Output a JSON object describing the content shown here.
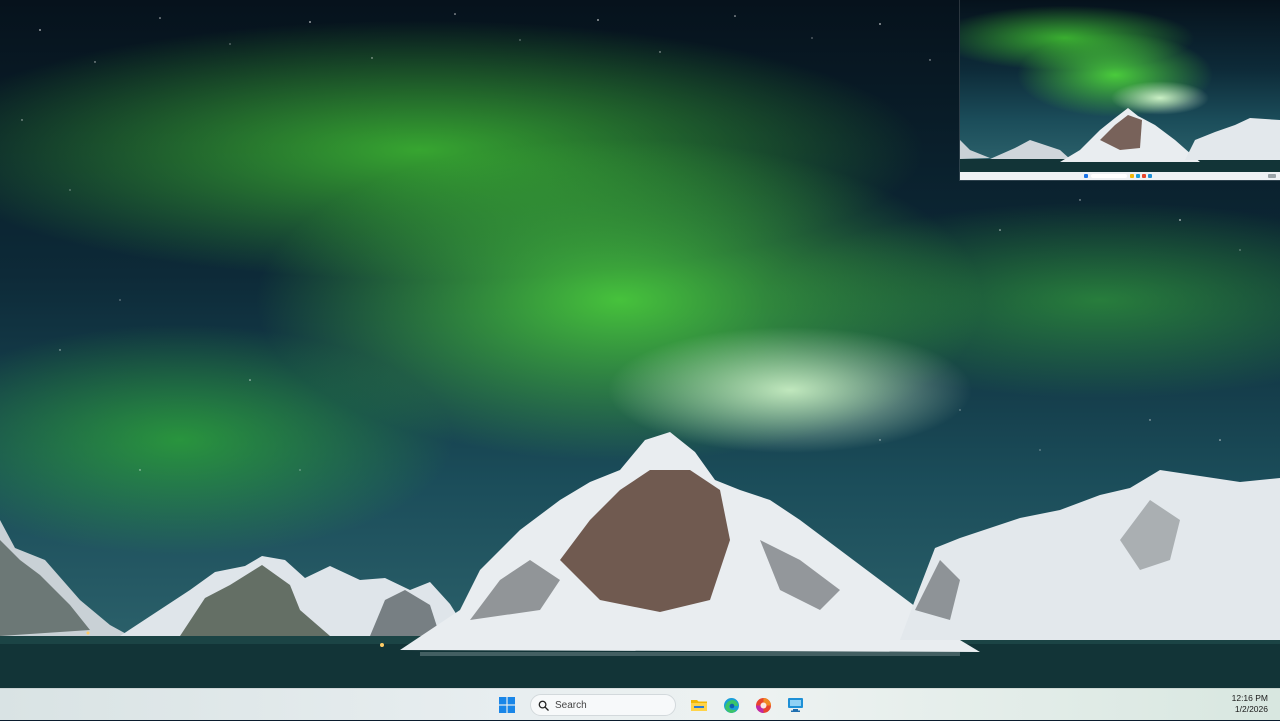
{
  "desktop": {
    "wallpaper": "aurora-borealis-over-snowy-mountains",
    "colors": {
      "aurora": "#5fe04a",
      "sky": "#0d2a38",
      "water": "#123437",
      "snow": "#e9edf0"
    }
  },
  "preview_thumbnail": {
    "label": ""
  },
  "taskbar": {
    "start_icon": "windows-start-icon",
    "search_placeholder": "Search",
    "pinned_apps": [
      {
        "name": "file-explorer-icon",
        "color": "#f2b705"
      },
      {
        "name": "edge-browser-icon",
        "color": "#1a9fd8"
      },
      {
        "name": "office-app-icon",
        "color": "#e8452c"
      },
      {
        "name": "remote-desktop-icon",
        "color": "#1e90d6"
      }
    ],
    "clock": {
      "time": "12:16 PM",
      "date": "1/2/2026"
    }
  }
}
